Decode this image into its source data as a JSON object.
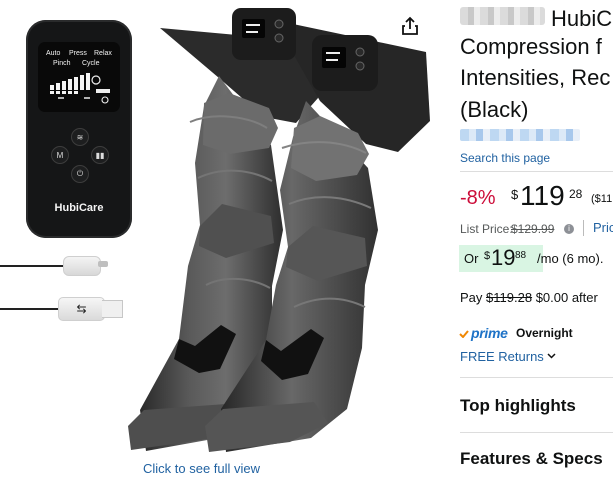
{
  "left_gallery": {
    "remote": {
      "brand": "HubiCare",
      "modes": [
        "Auto",
        "Press",
        "Relax"
      ],
      "settings": [
        "Pinch",
        "Cycle"
      ],
      "side_buttons": [
        "M"
      ]
    },
    "click_label": "Click to see full view"
  },
  "product": {
    "title_lines": [
      "HubiC",
      "Compression f",
      "Intensities, Rec",
      "(Black)"
    ],
    "search_link": "Search this page",
    "discount": "-8%",
    "price_symbol": "$",
    "price_main": "119",
    "price_cents": "28",
    "price_note": "($11",
    "list_label": "List Price:",
    "list_price": "$129.99",
    "info_icon": "i",
    "pri_link": "Pric",
    "monthly": {
      "or_label": "Or",
      "symbol": "$",
      "main": "19",
      "cents": "88",
      "tail": "/mo (6 mo)."
    },
    "pay_line": {
      "prefix": "Pay",
      "strike": "$119.28",
      "rest": "$0.00 after"
    },
    "prime": {
      "logo": "prime",
      "label": "Overnight"
    },
    "returns": "FREE Returns",
    "sections": [
      "Top highlights",
      "Features & Specs"
    ]
  },
  "icons": {
    "share": "share-icon",
    "chevron": "chevron-down-icon",
    "info": "info-icon",
    "prime_check": "check-icon"
  },
  "colors": {
    "link": "#2162a1",
    "discount": "#cc0c39",
    "deal_bg": "#d9f5e3",
    "prime_blue": "#1f73c7"
  }
}
